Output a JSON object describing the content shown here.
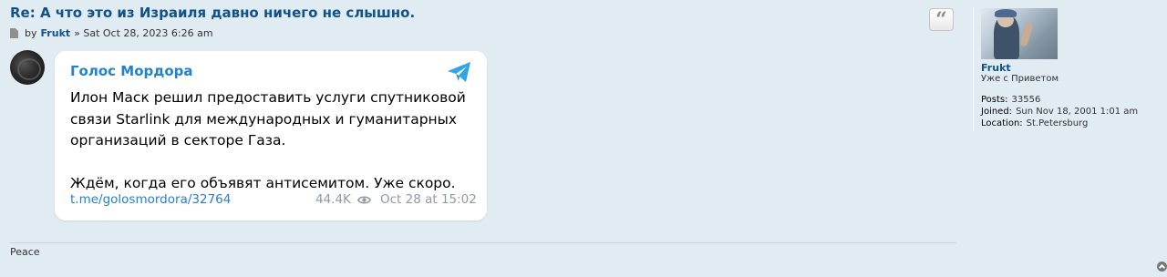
{
  "post": {
    "title": "Re: А что это из Израиля давно ничего не слышно.",
    "meta_by": "by",
    "author": "Frukt",
    "meta_date": "» Sat Oct 28, 2023 6:26 am",
    "quote_icon": "quote-icon"
  },
  "telegram": {
    "channel": "Голос Мордора",
    "paragraph1": "Илон Маск решил предоставить услуги спутниковой связи Starlink для международных и гуманитарных организаций в секторе Газа.",
    "paragraph2": "Ждём, когда его объявят антисемитом. Уже скоро.",
    "link": "t.me/golosmordora/32764",
    "views": "44.4K",
    "date": "Oct 28 at 15:02",
    "accent_color": "#2481cc"
  },
  "signature": "Peace",
  "profile": {
    "name": "Frukt",
    "rank": "Уже с Приветом",
    "posts_label": "Posts:",
    "posts_value": "33556",
    "joined_label": "Joined:",
    "joined_value": "Sun Nov 18, 2001 1:01 am",
    "location_label": "Location:",
    "location_value": "St.Petersburg"
  },
  "colors": {
    "background": "#e1ebf2",
    "link": "#105289"
  }
}
